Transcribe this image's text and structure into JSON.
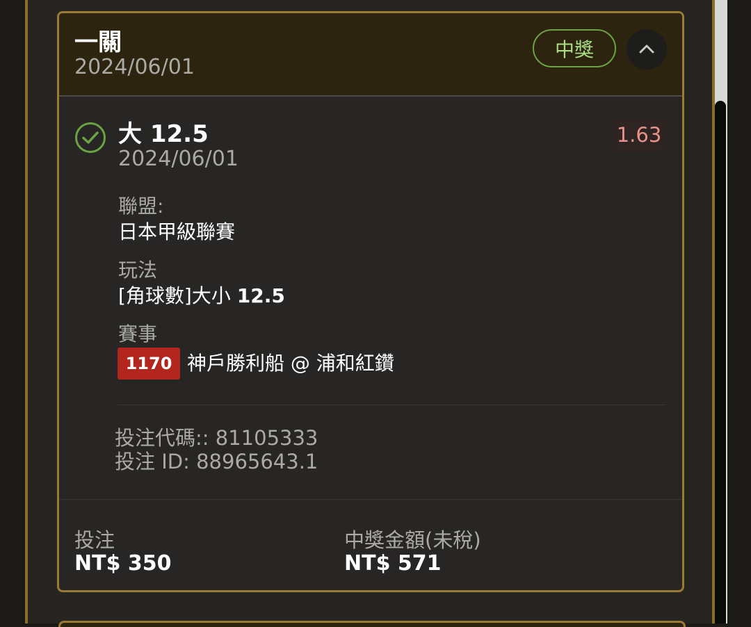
{
  "ticket": {
    "title": "一關",
    "date": "2024/06/01",
    "status_badge": "中獎",
    "collapse_icon": "chevron-up-icon"
  },
  "selection": {
    "status_icon": "check-circle-icon",
    "pick": "大",
    "line": "12.5",
    "date": "2024/06/01",
    "odds": "1.63",
    "league_label": "聯盟:",
    "league_value": "日本甲級聯賽",
    "market_label": "玩法",
    "market_value_prefix": "[角球數]大小",
    "market_value_line": "12.5",
    "event_label": "賽事",
    "event_id": "1170",
    "event_name": "神戶勝利船 @ 浦和紅鑽",
    "bet_code_label": "投注代碼::",
    "bet_code_value": "81105333",
    "bet_id_label": "投注 ID:",
    "bet_id_value": "88965643.1"
  },
  "summary": {
    "stake_label": "投注",
    "stake_value": "NT$ 350",
    "payout_label": "中獎金額(未稅)",
    "payout_value": "NT$ 571"
  },
  "colors": {
    "accent_gold": "#9b7a33",
    "win_green": "#6aa442",
    "odds_red": "#e6928a",
    "event_id_red": "#b3261e"
  }
}
